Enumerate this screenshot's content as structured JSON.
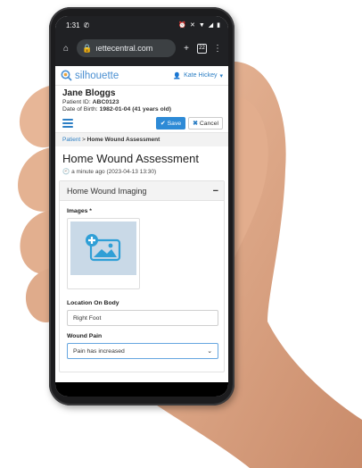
{
  "status_bar": {
    "time": "1:31",
    "icons": [
      "whatsapp-icon",
      "alarm-icon",
      "mute-icon",
      "wifi-icon",
      "signal-icon",
      "battery-icon"
    ]
  },
  "browser": {
    "url": "ıettecentral.com",
    "tabs_count": "22"
  },
  "app": {
    "logo": "silhouette",
    "user": "Kate Hickey"
  },
  "patient": {
    "name": "Jane Bloggs",
    "id_label": "Patient ID:",
    "id_value": "ABC0123",
    "dob_label": "Date of Birth:",
    "dob_value": "1982-01-04 (41 years old)"
  },
  "toolbar": {
    "save_label": "Save",
    "cancel_label": "Cancel"
  },
  "breadcrumb": {
    "root": "Patient",
    "separator": ">",
    "current": "Home Wound Assessment"
  },
  "page": {
    "title": "Home Wound Assessment",
    "timestamp": "a minute ago (2023-04-13 13:30)"
  },
  "section": {
    "title": "Home Wound Imaging",
    "images_label": "Images *",
    "location_label": "Location On Body",
    "location_value": "Right Foot",
    "pain_label": "Wound Pain",
    "pain_value": "Pain has increased"
  },
  "colors": {
    "accent": "#2d8ad6",
    "logo": "#4a8fd1",
    "image_placeholder": "#c9d9e7"
  }
}
